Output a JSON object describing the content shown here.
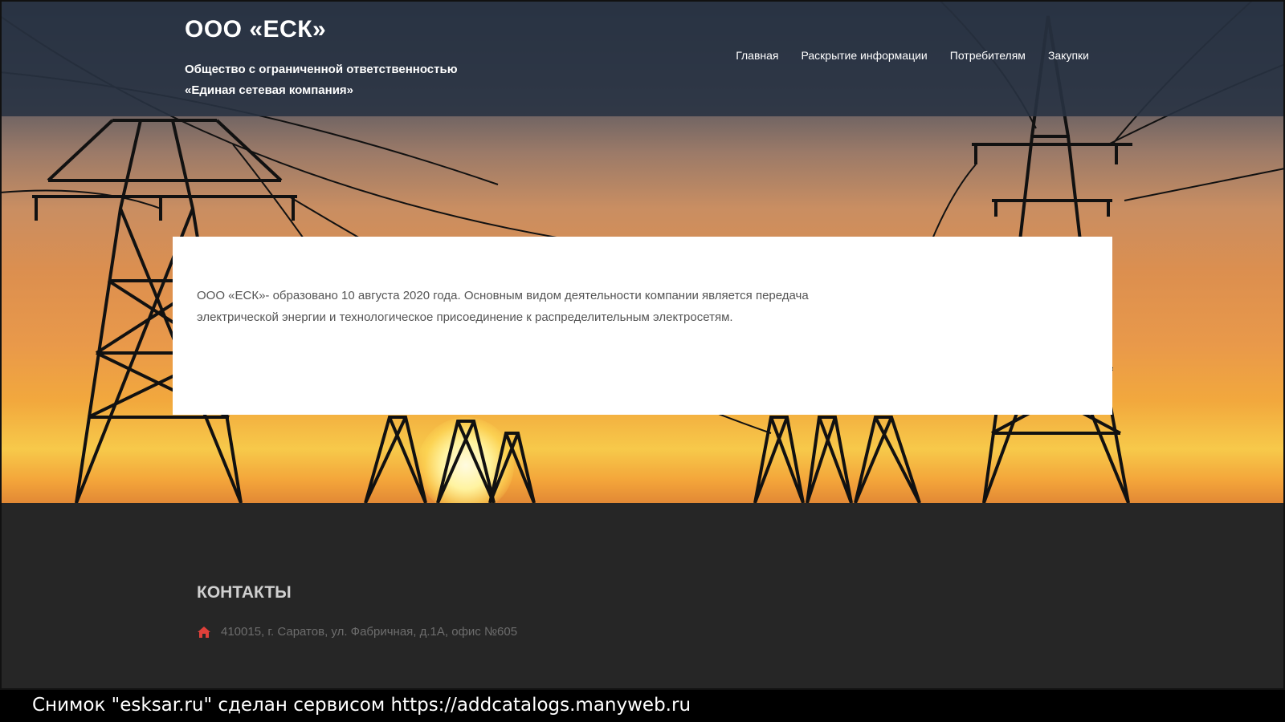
{
  "header": {
    "site_title": "ООО «ЕСК»",
    "site_description_line1": "Общество с ограниченной ответственностью",
    "site_description_line2": "«Единая сетевая компания»",
    "nav": [
      {
        "label": "Главная"
      },
      {
        "label": "Раскрытие информации"
      },
      {
        "label": "Потребителям"
      },
      {
        "label": "Закупки"
      }
    ]
  },
  "main": {
    "intro_text": "ООО «ЕСК»- образовано 10 августа 2020 года. Основным видом деятельности компании является передача электрической энергии и технологическое присоединение к распределительным электросетям."
  },
  "footer": {
    "contacts_title": "КОНТАКТЫ",
    "address_icon": "home-icon",
    "address": "410015, г. Саратов, ул. Фабричная, д.1А, офис №605",
    "accent_color": "#e0403a"
  },
  "caption": {
    "text": "Снимок \"esksar.ru\" сделан сервисом https://addcatalogs.manyweb.ru"
  }
}
